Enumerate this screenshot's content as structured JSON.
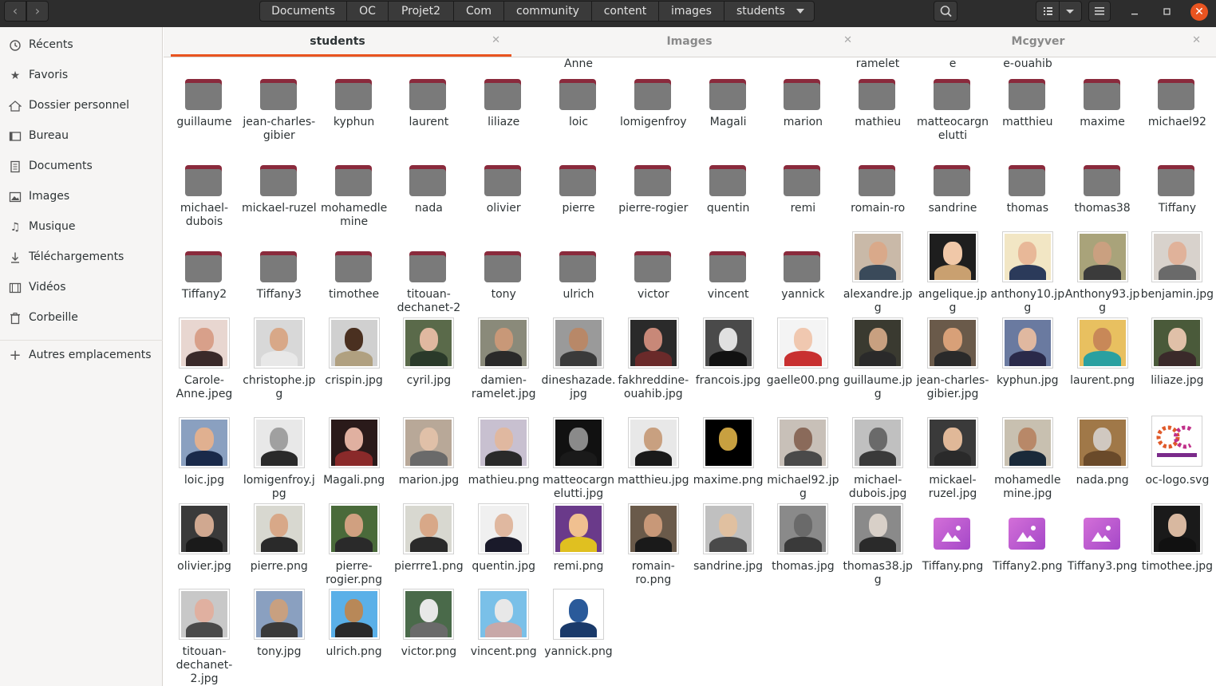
{
  "toolbar": {
    "back_icon": "chevron-left-icon",
    "forward_icon": "chevron-right-icon",
    "path": [
      "Documents",
      "OC",
      "Projet2",
      "Com",
      "community",
      "content",
      "images",
      "students"
    ],
    "search_icon": "search-icon",
    "view_list_icon": "list-view-icon",
    "view_options_icon": "chevron-down-icon",
    "menu_icon": "hamburger-menu-icon",
    "minimize_icon": "minimize-icon",
    "maximize_icon": "maximize-icon",
    "close_icon": "close-icon",
    "accent": "#e95420"
  },
  "sidebar": {
    "items": [
      {
        "label": "Récents",
        "icon": "clock-icon"
      },
      {
        "label": "Favoris",
        "icon": "star-icon"
      },
      {
        "label": "Dossier personnel",
        "icon": "home-icon"
      },
      {
        "label": "Bureau",
        "icon": "desktop-icon"
      },
      {
        "label": "Documents",
        "icon": "document-icon"
      },
      {
        "label": "Images",
        "icon": "image-icon"
      },
      {
        "label": "Musique",
        "icon": "music-icon"
      },
      {
        "label": "Téléchargements",
        "icon": "download-icon"
      },
      {
        "label": "Vidéos",
        "icon": "video-icon"
      },
      {
        "label": "Corbeille",
        "icon": "trash-icon"
      }
    ],
    "other_locations": "Autres emplacements"
  },
  "tabs": [
    {
      "label": "students",
      "active": true
    },
    {
      "label": "Images",
      "active": false
    },
    {
      "label": "Mcgyver",
      "active": false
    }
  ],
  "grid": {
    "partial_labels": [
      "Anne",
      "ramelet",
      "e",
      "e-ouahib"
    ],
    "rows": [
      [
        {
          "type": "folder",
          "label": "guillaume"
        },
        {
          "type": "folder",
          "label": "jean-charles-gibier"
        },
        {
          "type": "folder",
          "label": "kyphun"
        },
        {
          "type": "folder",
          "label": "laurent"
        },
        {
          "type": "folder",
          "label": "liliaze"
        },
        {
          "type": "folder",
          "label": "loic"
        },
        {
          "type": "folder",
          "label": "lomigenfroy"
        },
        {
          "type": "folder",
          "label": "Magali"
        },
        {
          "type": "folder",
          "label": "marion"
        },
        {
          "type": "folder",
          "label": "mathieu"
        },
        {
          "type": "folder",
          "label": "matteocargnelutti"
        },
        {
          "type": "folder",
          "label": "matthieu"
        },
        {
          "type": "folder",
          "label": "maxime"
        },
        {
          "type": "folder",
          "label": "michael92"
        }
      ],
      [
        {
          "type": "folder",
          "label": "michael-dubois"
        },
        {
          "type": "folder",
          "label": "mickael-ruzel"
        },
        {
          "type": "folder",
          "label": "mohamedlemine"
        },
        {
          "type": "folder",
          "label": "nada"
        },
        {
          "type": "folder",
          "label": "olivier"
        },
        {
          "type": "folder",
          "label": "pierre"
        },
        {
          "type": "folder",
          "label": "pierre-rogier"
        },
        {
          "type": "folder",
          "label": "quentin"
        },
        {
          "type": "folder",
          "label": "remi"
        },
        {
          "type": "folder",
          "label": "romain-ro"
        },
        {
          "type": "folder",
          "label": "sandrine"
        },
        {
          "type": "folder",
          "label": "thomas"
        },
        {
          "type": "folder",
          "label": "thomas38"
        },
        {
          "type": "folder",
          "label": "Tiffany"
        }
      ],
      [
        {
          "type": "folder",
          "label": "Tiffany2"
        },
        {
          "type": "folder",
          "label": "Tiffany3"
        },
        {
          "type": "folder",
          "label": "timothee"
        },
        {
          "type": "folder",
          "label": "titouan-dechanet-2"
        },
        {
          "type": "folder",
          "label": "tony"
        },
        {
          "type": "folder",
          "label": "ulrich"
        },
        {
          "type": "folder",
          "label": "victor"
        },
        {
          "type": "folder",
          "label": "vincent"
        },
        {
          "type": "folder",
          "label": "yannick"
        },
        {
          "type": "photo",
          "label": "alexandre.jpg",
          "bg": "#c9b9a8",
          "skin": "#d9a98a",
          "shirt": "#3a4a5a"
        },
        {
          "type": "photo",
          "label": "angelique.jpg",
          "bg": "#1e1e1e",
          "skin": "#f0c8a8",
          "shirt": "#c9a070"
        },
        {
          "type": "photo",
          "label": "anthony10.jpg",
          "bg": "#f2e6c4",
          "skin": "#e8b898",
          "shirt": "#2b3a5a"
        },
        {
          "type": "photo",
          "label": "Anthony93.jpg",
          "bg": "#a9a37a",
          "skin": "#caa080",
          "shirt": "#3b3b3b"
        },
        {
          "type": "photo",
          "label": "benjamin.jpg",
          "bg": "#d8d2cc",
          "skin": "#e0b29a",
          "shirt": "#6a6a6a"
        }
      ],
      [
        {
          "type": "photo",
          "label": "Carole-Anne.jpeg",
          "bg": "#e8d6d0",
          "skin": "#d8a08a",
          "shirt": "#3a2a2a"
        },
        {
          "type": "photo",
          "label": "christophe.jpg",
          "bg": "#d8d8d8",
          "skin": "#d8a888",
          "shirt": "#e8e8e8"
        },
        {
          "type": "photo",
          "label": "crispin.jpg",
          "bg": "#d0d0d0",
          "skin": "#4a3020",
          "shirt": "#b0a080"
        },
        {
          "type": "photo",
          "label": "cyril.jpg",
          "bg": "#5a6a4a",
          "skin": "#e0b8a0",
          "shirt": "#2a3a2a"
        },
        {
          "type": "photo",
          "label": "damien-ramelet.jpg",
          "bg": "#8a8a7a",
          "skin": "#c89878",
          "shirt": "#2a2a2a"
        },
        {
          "type": "photo",
          "label": "dineshazade.jpg",
          "bg": "#9a9a9a",
          "skin": "#b88868",
          "shirt": "#3a3a3a"
        },
        {
          "type": "photo",
          "label": "fakhreddine-ouahib.jpg",
          "bg": "#2a2a2a",
          "skin": "#c88878",
          "shirt": "#6a2a2a"
        },
        {
          "type": "photo",
          "label": "francois.jpg",
          "bg": "#4a4a4a",
          "skin": "#e0e0e0",
          "shirt": "#111111"
        },
        {
          "type": "photo",
          "label": "gaelle00.png",
          "bg": "#f4f4f4",
          "skin": "#f0c8b0",
          "shirt": "#c83030"
        },
        {
          "type": "photo",
          "label": "guillaume.jpg",
          "bg": "#3a3a30",
          "skin": "#c8a080",
          "shirt": "#2a2a2a"
        },
        {
          "type": "photo",
          "label": "jean-charles-gibier.jpg",
          "bg": "#6a5a4a",
          "skin": "#d8a078",
          "shirt": "#2a2a2a"
        },
        {
          "type": "photo",
          "label": "kyphun.jpg",
          "bg": "#6a7aa0",
          "skin": "#e0b8a0",
          "shirt": "#2a2a4a"
        },
        {
          "type": "photo",
          "label": "laurent.png",
          "bg": "#e8c060",
          "skin": "#c88858",
          "shirt": "#2aa0a0"
        },
        {
          "type": "photo",
          "label": "liliaze.jpg",
          "bg": "#4a5a3a",
          "skin": "#e0c0a8",
          "shirt": "#3a2a2a"
        }
      ],
      [
        {
          "type": "photo",
          "label": "loic.jpg",
          "bg": "#8aa0c0",
          "skin": "#e0b090",
          "shirt": "#1a2a4a"
        },
        {
          "type": "photo",
          "label": "lomigenfroy.jpg",
          "bg": "#e8e8e8",
          "skin": "#a0a0a0",
          "shirt": "#2a2a2a"
        },
        {
          "type": "photo",
          "label": "Magali.png",
          "bg": "#2a1a1a",
          "skin": "#e0b0a0",
          "shirt": "#8a2a2a"
        },
        {
          "type": "photo",
          "label": "marion.jpg",
          "bg": "#b8a898",
          "skin": "#e0c0a8",
          "shirt": "#6a6a6a"
        },
        {
          "type": "photo",
          "label": "mathieu.png",
          "bg": "#c8c0d0",
          "skin": "#e0b8a0",
          "shirt": "#2a2a2a"
        },
        {
          "type": "photo",
          "label": "matteocargnelutti.jpg",
          "bg": "#111111",
          "skin": "#8a8a8a",
          "shirt": "#1a1a1a"
        },
        {
          "type": "photo",
          "label": "matthieu.jpg",
          "bg": "#e8e8e8",
          "skin": "#c8a080",
          "shirt": "#1a1a1a"
        },
        {
          "type": "photo",
          "label": "maxime.png",
          "bg": "#000000",
          "skin": "#c8a040",
          "shirt": "#000000"
        },
        {
          "type": "photo",
          "label": "michael92.jpg",
          "bg": "#c8c0b8",
          "skin": "#8a6a5a",
          "shirt": "#4a4a4a"
        },
        {
          "type": "photo",
          "label": "michael-dubois.jpg",
          "bg": "#c0c0c0",
          "skin": "#6a6a6a",
          "shirt": "#3a3a3a"
        },
        {
          "type": "photo",
          "label": "mickael-ruzel.jpg",
          "bg": "#3a3a3a",
          "skin": "#e0b898",
          "shirt": "#2a2a2a"
        },
        {
          "type": "photo",
          "label": "mohamedlemine.jpg",
          "bg": "#c8c0b0",
          "skin": "#b88868",
          "shirt": "#1a2a3a"
        },
        {
          "type": "photo",
          "label": "nada.png",
          "bg": "#a07848",
          "skin": "#d0c8c0",
          "shirt": "#6a4a2a"
        },
        {
          "type": "logo",
          "label": "oc-logo.svg"
        }
      ],
      [
        {
          "type": "photo",
          "label": "olivier.jpg",
          "bg": "#3a3a3a",
          "skin": "#d0a890",
          "shirt": "#1a1a1a"
        },
        {
          "type": "photo",
          "label": "pierre.png",
          "bg": "#d8d8d0",
          "skin": "#d8a888",
          "shirt": "#2a2a2a"
        },
        {
          "type": "photo",
          "label": "pierre-rogier.png",
          "bg": "#4a6a3a",
          "skin": "#d0a080",
          "shirt": "#2a2a2a"
        },
        {
          "type": "photo",
          "label": "pierrre1.png",
          "bg": "#d8d8d0",
          "skin": "#d8a888",
          "shirt": "#2a2a2a"
        },
        {
          "type": "photo",
          "label": "quentin.jpg",
          "bg": "#f0f0f0",
          "skin": "#e0b8a0",
          "shirt": "#1a1a2a"
        },
        {
          "type": "photo",
          "label": "remi.png",
          "bg": "#6a3a8a",
          "skin": "#f0c090",
          "shirt": "#e0c020"
        },
        {
          "type": "photo",
          "label": "romain-ro.png",
          "bg": "#6a5a4a",
          "skin": "#c89878",
          "shirt": "#1a1a1a"
        },
        {
          "type": "photo",
          "label": "sandrine.jpg",
          "bg": "#c0c0c0",
          "skin": "#e0c0a0",
          "shirt": "#4a4a4a"
        },
        {
          "type": "photo",
          "label": "thomas.jpg",
          "bg": "#8a8a8a",
          "skin": "#6a6a6a",
          "shirt": "#3a3a3a"
        },
        {
          "type": "photo",
          "label": "thomas38.jpg",
          "bg": "#8a8a8a",
          "skin": "#d8d0c8",
          "shirt": "#2a2a2a"
        },
        {
          "type": "image",
          "label": "Tiffany.png"
        },
        {
          "type": "image",
          "label": "Tiffany2.png"
        },
        {
          "type": "image",
          "label": "Tiffany3.png"
        },
        {
          "type": "photo",
          "label": "timothee.jpg",
          "bg": "#1a1a1a",
          "skin": "#d8b8a0",
          "shirt": "#111111"
        }
      ],
      [
        {
          "type": "photo",
          "label": "titouan-dechanet-2.jpg",
          "bg": "#c8c8c8",
          "skin": "#e0b0a0",
          "shirt": "#4a4a4a"
        },
        {
          "type": "photo",
          "label": "tony.jpg",
          "bg": "#8aa0c0",
          "skin": "#c8a080",
          "shirt": "#3a3a3a"
        },
        {
          "type": "photo",
          "label": "ulrich.png",
          "bg": "#5ab0e8",
          "skin": "#b88858",
          "shirt": "#2a2a2a"
        },
        {
          "type": "photo",
          "label": "victor.png",
          "bg": "#4a6a4a",
          "skin": "#e8e8e8",
          "shirt": "#6a6a6a"
        },
        {
          "type": "photo",
          "label": "vincent.png",
          "bg": "#7ac0e8",
          "skin": "#e8e8e8",
          "shirt": "#c8a8a8"
        },
        {
          "type": "photo",
          "label": "yannick.png",
          "bg": "#ffffff",
          "skin": "#2a5a9a",
          "shirt": "#1a3a6a"
        }
      ]
    ]
  }
}
